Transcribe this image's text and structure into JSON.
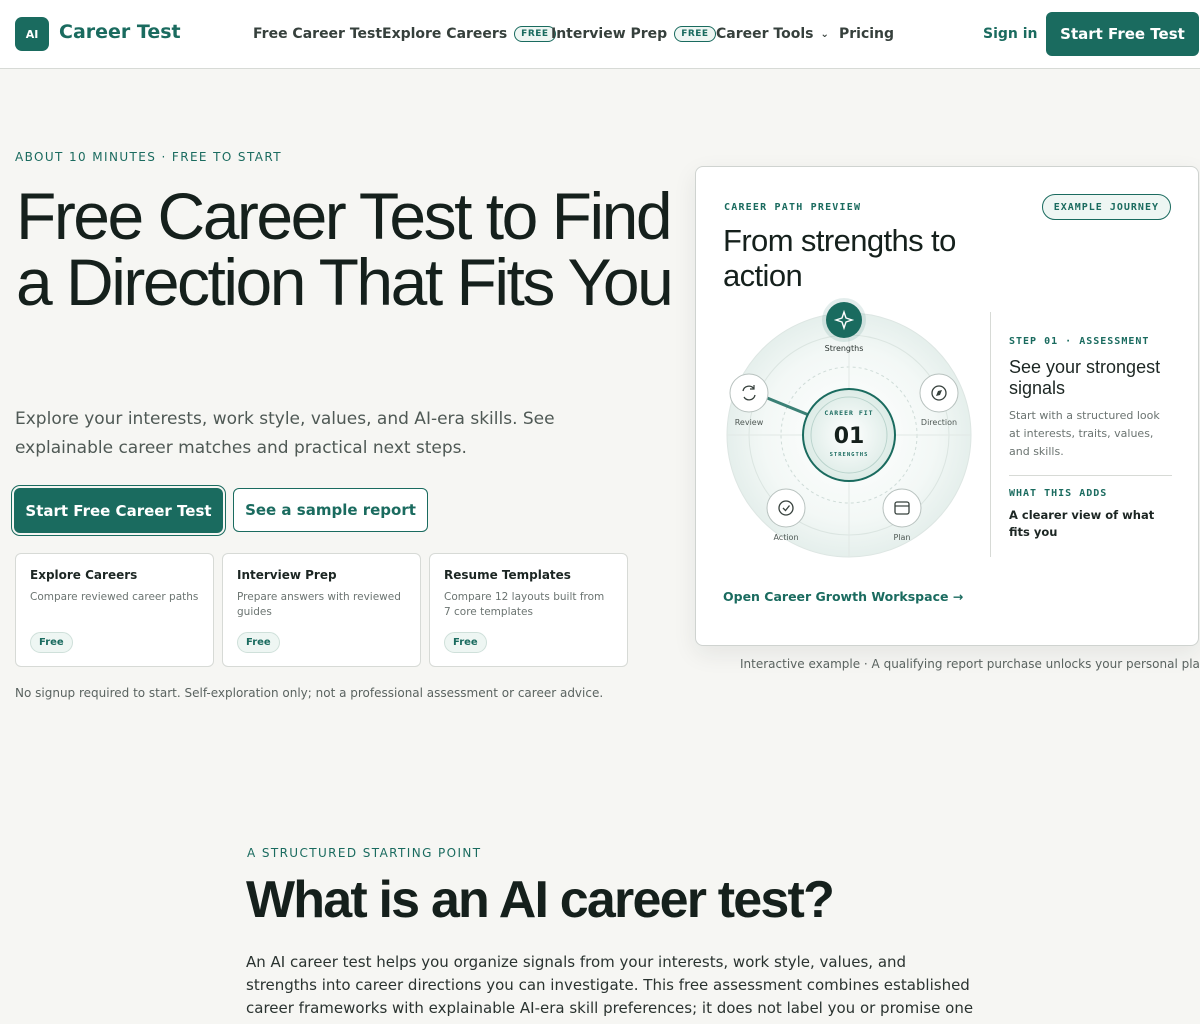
{
  "header": {
    "logo_mark": "AI",
    "logo_text": "Career Test",
    "nav": [
      {
        "label": "Free Career Test"
      },
      {
        "label": "Explore Careers",
        "badge": "FREE"
      },
      {
        "label": "Interview Prep",
        "badge": "FREE"
      },
      {
        "label": "Career Tools"
      },
      {
        "label": "Pricing"
      }
    ],
    "signin": "Sign in",
    "cta": "Start Free Test"
  },
  "hero": {
    "eyebrow": "ABOUT 10 MINUTES · FREE TO START",
    "title": "Free Career Test to Find a Direction That Fits You",
    "subtitle": "Explore your interests, work style, values, and AI-era skills. See explainable career matches and practical next steps.",
    "primary_button": "Start Free Career Test",
    "secondary_button": "See a sample report",
    "cards": [
      {
        "title": "Explore Careers",
        "desc": "Compare reviewed career paths",
        "badge": "Free"
      },
      {
        "title": "Interview Prep",
        "desc": "Prepare answers with reviewed guides",
        "badge": "Free"
      },
      {
        "title": "Resume Templates",
        "desc": "Compare 12 layouts built from 7 core templates",
        "badge": "Free"
      }
    ],
    "disclaimer": "No signup required to start. Self-exploration only; not a professional assessment or career advice."
  },
  "preview": {
    "eyebrow": "CAREER PATH PREVIEW",
    "badge": "EXAMPLE JOURNEY",
    "title": "From strengths to action",
    "wheel": {
      "center_label": "CAREER FIT",
      "center_value": "01",
      "center_sub": "STRENGTHS",
      "nodes": [
        "Strengths",
        "Direction",
        "Plan",
        "Action",
        "Review"
      ]
    },
    "step_label": "STEP 01 · ASSESSMENT",
    "step_title": "See your strongest signals",
    "step_desc": "Start with a structured look at interests, traits, values, and skills.",
    "adds_label": "WHAT THIS ADDS",
    "adds_text": "A clearer view of what fits you",
    "link": "Open Career Growth Workspace  →",
    "caption": "Interactive example · A qualifying report purchase unlocks your personal plan"
  },
  "section2": {
    "eyebrow": "A STRUCTURED STARTING POINT",
    "title": "What is an AI career test?",
    "body": "An AI career test helps you organize signals from your interests, work style, values, and strengths into career directions you can investigate. This free assessment combines established career frameworks with explainable AI-era skill preferences; it does not label you or promise one correct job."
  },
  "colors": {
    "accent": "#1a6b5f",
    "background": "#f6f6f3"
  }
}
